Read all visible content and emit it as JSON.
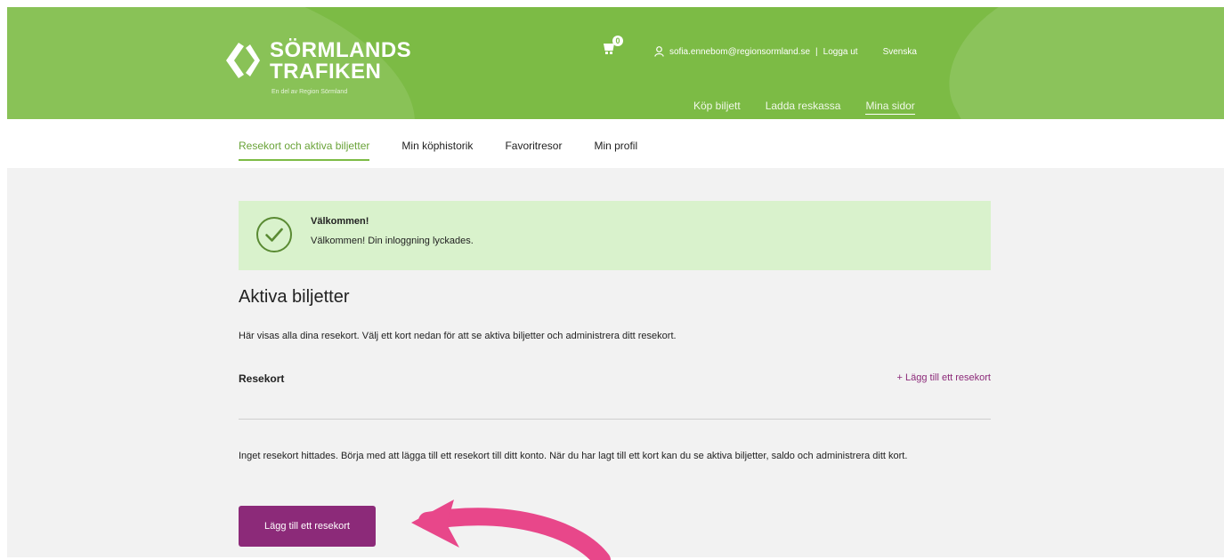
{
  "colors": {
    "brand_green": "#7cbb45",
    "success_bg": "#d9f2cc",
    "accent_purple": "#8c2a79",
    "annotation_pink": "#e8478a"
  },
  "header": {
    "logo_line1": "SÖRMLANDS",
    "logo_line2": "TRAFIKEN",
    "logo_tagline": "En del av Region Sörmland",
    "cart_count": "0",
    "user_email": "sofia.ennebom@regionsormland.se",
    "separator": "|",
    "logout": "Logga ut",
    "language": "Svenska",
    "nav": [
      "Köp biljett",
      "Ladda reskassa",
      "Mina sidor"
    ]
  },
  "subnav": {
    "tabs": [
      "Resekort och aktiva biljetter",
      "Min köphistorik",
      "Favoritresor",
      "Min profil"
    ]
  },
  "alert": {
    "title": "Välkommen!",
    "message": "Välkommen! Din inloggning lyckades."
  },
  "main": {
    "title": "Aktiva biljetter",
    "description": "Här visas alla dina resekort. Välj ett kort nedan för att se aktiva biljetter och administrera ditt resekort.",
    "cards_label": "Resekort",
    "add_card_link": "+ Lägg till ett resekort",
    "empty_message": "Inget resekort hittades. Börja med att lägga till ett resekort till ditt konto. När du har lagt till ett kort kan du se aktiva biljetter, saldo och administrera ditt kort.",
    "add_card_button": "Lägg till ett resekort"
  },
  "icons": {
    "logo_mark": "sormlandstrafiken-logo-icon",
    "cart": "cart-icon",
    "user": "user-icon",
    "success": "check-circle-icon",
    "annotation": "curved-arrow-icon"
  }
}
